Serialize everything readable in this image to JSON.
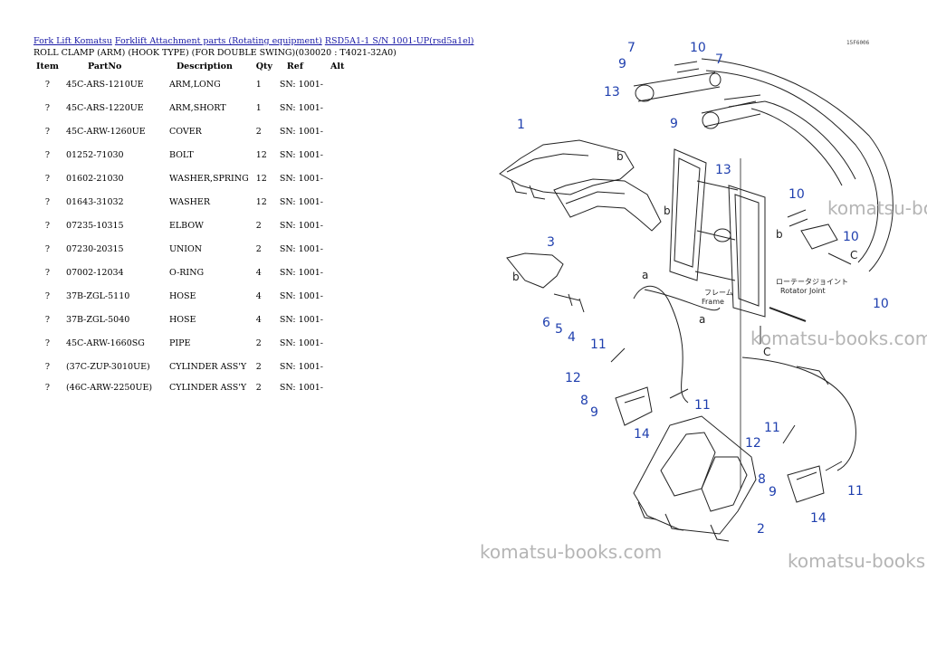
{
  "breadcrumb": [
    {
      "label": "Fork Lift Komatsu"
    },
    {
      "label": "Forklift Attachment parts (Rotating equipment)"
    },
    {
      "label": "RSD5A1-1 S/N 1001-UP(rsd5a1el)"
    }
  ],
  "subtitle": "ROLL CLAMP (ARM) (HOOK TYPE) (FOR DOUBLE SWING)(030020 : T4021-32A0)",
  "table": {
    "headers": {
      "item": "Item",
      "partno": "PartNo",
      "desc": "Description",
      "qty": "Qty",
      "ref": "Ref",
      "alt": "Alt"
    },
    "rows": [
      {
        "item": "?",
        "partno": "45C-ARS-1210UE",
        "desc": "ARM,LONG",
        "qty": "1",
        "ref": "SN: 1001-"
      },
      {
        "item": "?",
        "partno": "45C-ARS-1220UE",
        "desc": "ARM,SHORT",
        "qty": "1",
        "ref": "SN: 1001-"
      },
      {
        "item": "?",
        "partno": "45C-ARW-1260UE",
        "desc": "COVER",
        "qty": "2",
        "ref": "SN: 1001-"
      },
      {
        "item": "?",
        "partno": "01252-71030",
        "desc": "BOLT",
        "qty": "12",
        "ref": "SN: 1001-"
      },
      {
        "item": "?",
        "partno": "01602-21030",
        "desc": "WASHER,SPRING",
        "qty": "12",
        "ref": "SN: 1001-"
      },
      {
        "item": "?",
        "partno": "01643-31032",
        "desc": "WASHER",
        "qty": "12",
        "ref": "SN: 1001-"
      },
      {
        "item": "?",
        "partno": "07235-10315",
        "desc": "ELBOW",
        "qty": "2",
        "ref": "SN: 1001-"
      },
      {
        "item": "?",
        "partno": "07230-20315",
        "desc": "UNION",
        "qty": "2",
        "ref": "SN: 1001-"
      },
      {
        "item": "?",
        "partno": "07002-12034",
        "desc": "O-RING",
        "qty": "4",
        "ref": "SN: 1001-"
      },
      {
        "item": "?",
        "partno": "37B-ZGL-5110",
        "desc": "HOSE",
        "qty": "4",
        "ref": "SN: 1001-"
      },
      {
        "item": "?",
        "partno": "37B-ZGL-5040",
        "desc": "HOSE",
        "qty": "4",
        "ref": "SN: 1001-"
      },
      {
        "item": "?",
        "partno": "45C-ARW-1660SG",
        "desc": "PIPE",
        "qty": "2",
        "ref": "SN: 1001-"
      },
      {
        "item": "?",
        "partno": "(37C-ZUP-3010UE)",
        "desc": "CYLINDER ASS'Y",
        "qty": "2",
        "ref": "SN: 1001-"
      },
      {
        "item": "?",
        "partno": "(46C-ARW-2250UE)",
        "desc": "CYLINDER ASS'Y",
        "qty": "2",
        "ref": "SN: 1001-"
      }
    ]
  },
  "diagram": {
    "figure_code": "15F6006",
    "callouts": [
      "7",
      "10",
      "9",
      "7",
      "13",
      "1",
      "9",
      "13",
      "10",
      "10",
      "3",
      "5",
      "6",
      "4",
      "11",
      "12",
      "8",
      "9",
      "11",
      "14",
      "11",
      "12",
      "8",
      "9",
      "11",
      "14",
      "2",
      "10"
    ],
    "letters": [
      "b",
      "b",
      "b",
      "a",
      "C",
      "C",
      "b",
      "a"
    ],
    "rotator_joint_jp": "ローテータジョイント",
    "rotator_joint_en": "Rotator Joint",
    "frame_jp": "フレーム",
    "frame_en": "Frame"
  },
  "watermarks": [
    "komatsu-books.com",
    "komatsu-books.com",
    "komatsu-books.com",
    "komatsu-books.com"
  ],
  "colors": {
    "link": "#1a1aa6",
    "callout": "#1f3fae",
    "watermark": "#b5b5b5"
  }
}
